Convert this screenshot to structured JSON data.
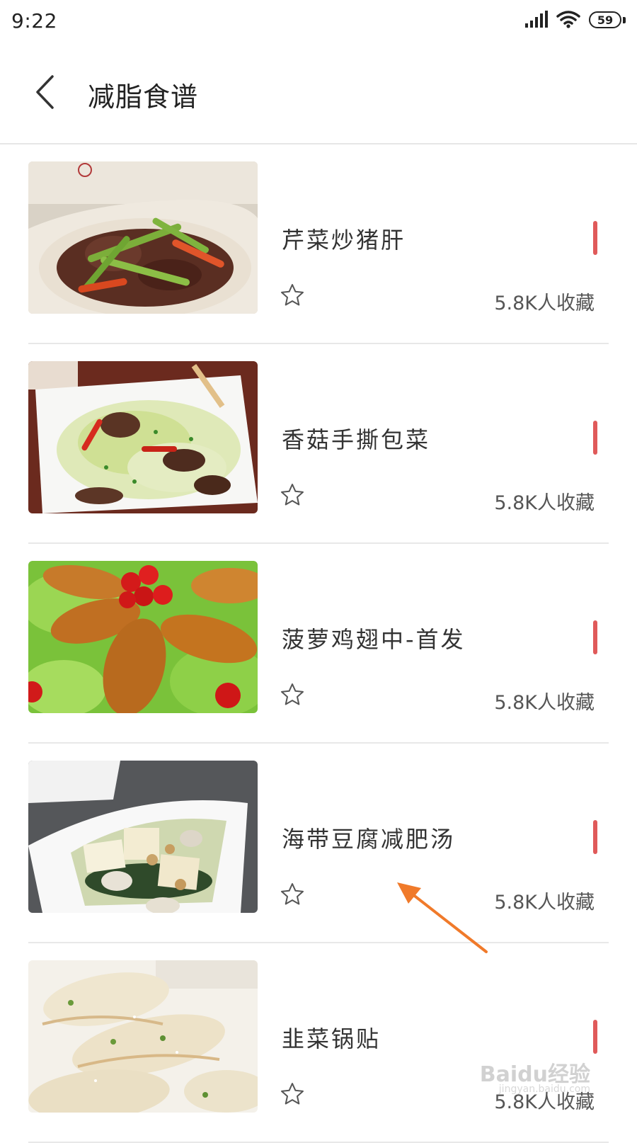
{
  "status_bar": {
    "time": "9:22",
    "battery": "59",
    "icons": [
      "signal-icon",
      "wifi-icon",
      "battery-icon"
    ]
  },
  "header": {
    "back_icon": "chevron-left-icon",
    "title": "减脂食谱"
  },
  "colors": {
    "accent_red": "#e05a5a",
    "annotation_orange": "#f07a2a",
    "divider": "#e8e8e8"
  },
  "recipes": [
    {
      "name": "芹菜炒猪肝",
      "favorites": "5.8K人收藏",
      "star_icon": "star-outline-icon"
    },
    {
      "name": "香菇手撕包菜",
      "favorites": "5.8K人收藏",
      "star_icon": "star-outline-icon"
    },
    {
      "name": "菠萝鸡翅中-首发",
      "favorites": "5.8K人收藏",
      "star_icon": "star-outline-icon"
    },
    {
      "name": "海带豆腐减肥汤",
      "favorites": "5.8K人收藏",
      "star_icon": "star-outline-icon"
    },
    {
      "name": "韭菜锅贴",
      "favorites": "5.8K人收藏",
      "star_icon": "star-outline-icon"
    }
  ],
  "watermark": {
    "text": "Baidu经验",
    "sub": "jingyan.baidu.com"
  }
}
